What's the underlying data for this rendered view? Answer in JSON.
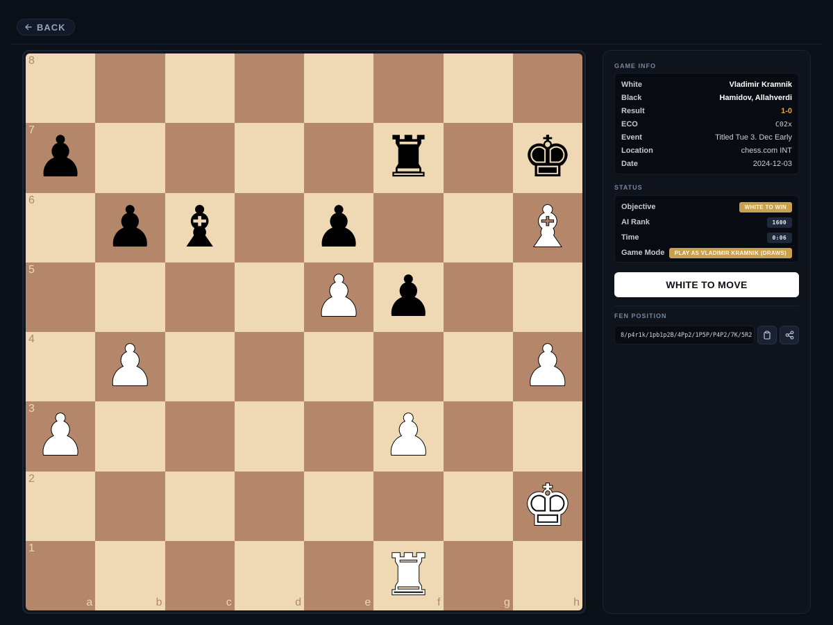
{
  "nav": {
    "back_label": "BACK"
  },
  "board": {
    "ranks": [
      "8",
      "7",
      "6",
      "5",
      "4",
      "3",
      "2",
      "1"
    ],
    "files": [
      "a",
      "b",
      "c",
      "d",
      "e",
      "f",
      "g",
      "h"
    ],
    "light_color": "#efd9b4",
    "dark_color": "#b4876a",
    "pieces": {
      "a7": "black-pawn",
      "f7": "black-rook",
      "h7": "black-king",
      "b6": "black-pawn",
      "c6": "black-bishop",
      "e6": "black-pawn",
      "h6": "white-bishop",
      "e5": "white-pawn",
      "f5": "black-pawn",
      "b4": "white-pawn",
      "h4": "white-pawn",
      "a3": "white-pawn",
      "f3": "white-pawn",
      "h2": "white-king",
      "f1": "white-rook"
    }
  },
  "game_info": {
    "title": "GAME INFO",
    "rows": [
      {
        "key": "White",
        "value": "Vladimir Kramnik"
      },
      {
        "key": "Black",
        "value": "Hamidov, Allahverdi"
      },
      {
        "key": "Result",
        "value": "1-0"
      },
      {
        "key": "ECO",
        "value": "C02x"
      },
      {
        "key": "Event",
        "value": "Titled Tue 3. Dec Early"
      },
      {
        "key": "Location",
        "value": "chess.com INT"
      },
      {
        "key": "Date",
        "value": "2024-12-03"
      }
    ]
  },
  "status": {
    "title": "STATUS",
    "rows": [
      {
        "key": "Objective",
        "value": "WHITE TO WIN"
      },
      {
        "key": "AI Rank",
        "value": "1600"
      },
      {
        "key": "Time",
        "value": "0:06"
      },
      {
        "key": "Game Mode",
        "value": "PLAY AS VLADIMIR KRAMNIK (DRAWS)"
      }
    ]
  },
  "move_button_label": "WHITE TO MOVE",
  "fen": {
    "title": "FEN POSITION",
    "value": "8/p4r1k/1pb1p2B/4Pp2/1P5P/P4P2/7K/5R2"
  },
  "icons": {
    "back": "arrow-left-icon",
    "copy": "clipboard-icon",
    "share": "share-icon"
  }
}
